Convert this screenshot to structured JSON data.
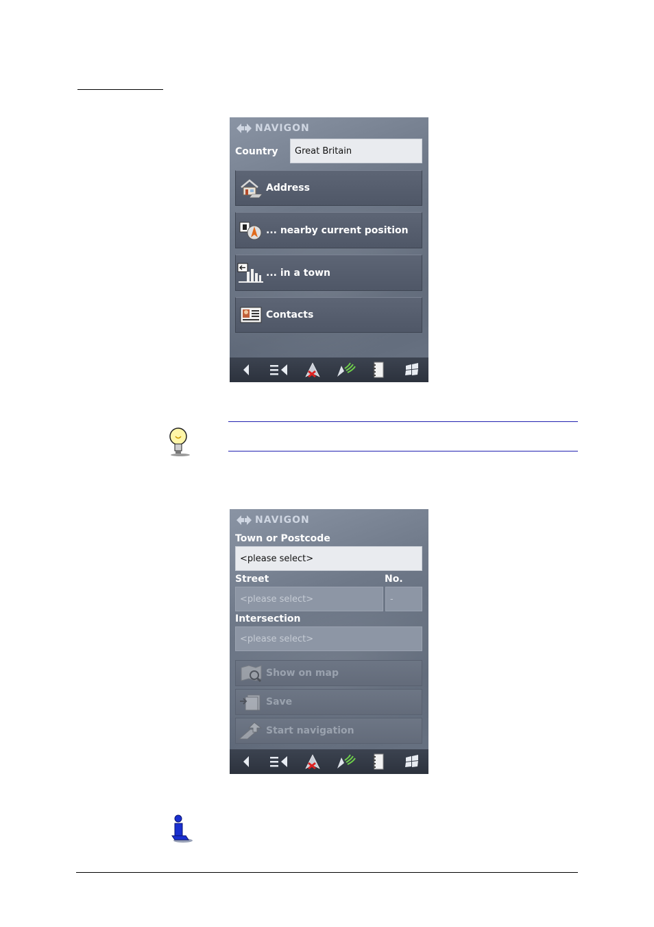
{
  "screen1": {
    "brand": "NAVIGON",
    "country_label": "Country",
    "country_value": "Great Britain",
    "menu": [
      {
        "label": "Address",
        "icon": "house-icon"
      },
      {
        "label": "... nearby current position",
        "icon": "poi-position-icon"
      },
      {
        "label": "... in a town",
        "icon": "town-icon"
      },
      {
        "label": "Contacts",
        "icon": "contacts-icon"
      }
    ]
  },
  "screen2": {
    "brand": "NAVIGON",
    "town_label": "Town or Postcode",
    "town_value": "<please select>",
    "street_label": "Street",
    "street_value": "<please select>",
    "no_label": "No.",
    "no_value": "-",
    "intersection_label": "Intersection",
    "intersection_value": "<please select>",
    "buttons": [
      {
        "label": "Show on map",
        "icon": "show-on-map-icon"
      },
      {
        "label": "Save",
        "icon": "save-icon"
      },
      {
        "label": "Start navigation",
        "icon": "start-navigation-icon"
      }
    ]
  },
  "toolbar_icons": [
    "back-icon",
    "menu-icon",
    "navigation-status-icon",
    "gps-signal-icon",
    "notebook-icon",
    "windows-icon"
  ],
  "colors": {
    "screen_bg": "#6e7888",
    "button_bg": "#525a6a",
    "field_bg": "#e9ebef",
    "toolbar_bg": "#343a46",
    "rule_blue": "#1f1fb0"
  }
}
